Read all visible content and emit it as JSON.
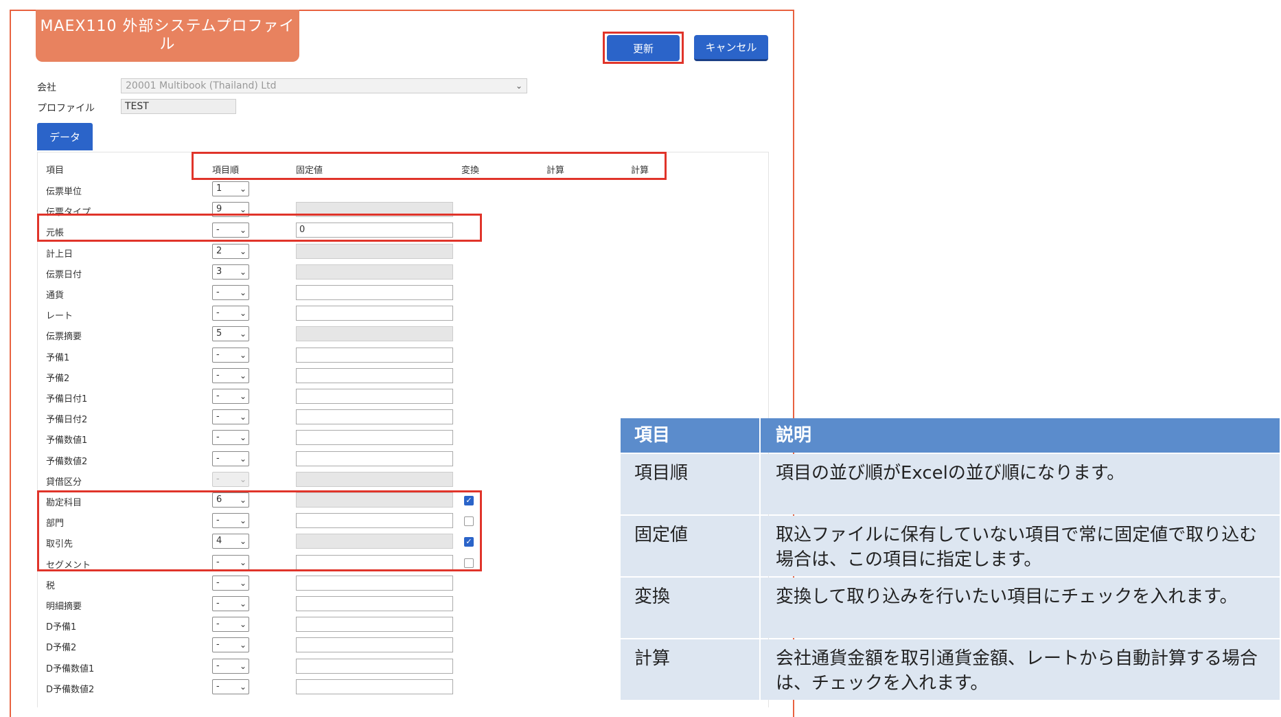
{
  "app": {
    "title": "MAEX110 外部システムプロファイル",
    "update_label": "更新",
    "cancel_label": "キャンセル",
    "accent": "#2b64c9",
    "title_color": "#e8825f",
    "highlight": "#e0342a"
  },
  "form": {
    "company_label": "会社",
    "company_value": "20001 Multibook (Thailand) Ltd",
    "profile_label": "プロファイル",
    "profile_value": "TEST"
  },
  "tabs": {
    "data_label": "データ"
  },
  "grid": {
    "headers": {
      "item": "項目",
      "order": "項目順",
      "fixed": "固定値",
      "convert": "変換",
      "calc1": "計算",
      "calc2": "計算"
    },
    "rows": [
      {
        "label": "伝票単位",
        "order": "1",
        "fixed": "",
        "fixed_disabled": false,
        "show_fixed": false,
        "checkbox": null,
        "order_disabled": false
      },
      {
        "label": "伝票タイプ",
        "order": "9",
        "fixed": "",
        "fixed_disabled": true,
        "show_fixed": true,
        "checkbox": null,
        "order_disabled": false
      },
      {
        "label": "元帳",
        "order": "-",
        "fixed": "0",
        "fixed_disabled": false,
        "show_fixed": true,
        "checkbox": null,
        "order_disabled": false
      },
      {
        "label": "計上日",
        "order": "2",
        "fixed": "",
        "fixed_disabled": true,
        "show_fixed": true,
        "checkbox": null,
        "order_disabled": false
      },
      {
        "label": "伝票日付",
        "order": "3",
        "fixed": "",
        "fixed_disabled": true,
        "show_fixed": true,
        "checkbox": null,
        "order_disabled": false
      },
      {
        "label": "通貨",
        "order": "-",
        "fixed": "",
        "fixed_disabled": false,
        "show_fixed": true,
        "checkbox": null,
        "order_disabled": false
      },
      {
        "label": "レート",
        "order": "-",
        "fixed": "",
        "fixed_disabled": false,
        "show_fixed": true,
        "checkbox": null,
        "order_disabled": false
      },
      {
        "label": "伝票摘要",
        "order": "5",
        "fixed": "",
        "fixed_disabled": true,
        "show_fixed": true,
        "checkbox": null,
        "order_disabled": false
      },
      {
        "label": "予備1",
        "order": "-",
        "fixed": "",
        "fixed_disabled": false,
        "show_fixed": true,
        "checkbox": null,
        "order_disabled": false
      },
      {
        "label": "予備2",
        "order": "-",
        "fixed": "",
        "fixed_disabled": false,
        "show_fixed": true,
        "checkbox": null,
        "order_disabled": false
      },
      {
        "label": "予備日付1",
        "order": "-",
        "fixed": "",
        "fixed_disabled": false,
        "show_fixed": true,
        "checkbox": null,
        "order_disabled": false
      },
      {
        "label": "予備日付2",
        "order": "-",
        "fixed": "",
        "fixed_disabled": false,
        "show_fixed": true,
        "checkbox": null,
        "order_disabled": false
      },
      {
        "label": "予備数値1",
        "order": "-",
        "fixed": "",
        "fixed_disabled": false,
        "show_fixed": true,
        "checkbox": null,
        "order_disabled": false
      },
      {
        "label": "予備数値2",
        "order": "-",
        "fixed": "",
        "fixed_disabled": false,
        "show_fixed": true,
        "checkbox": null,
        "order_disabled": false
      },
      {
        "label": "貸借区分",
        "order": "-",
        "fixed": "",
        "fixed_disabled": true,
        "show_fixed": true,
        "checkbox": null,
        "order_disabled": true
      },
      {
        "label": "勘定科目",
        "order": "6",
        "fixed": "",
        "fixed_disabled": true,
        "show_fixed": true,
        "checkbox": true,
        "order_disabled": false
      },
      {
        "label": "部門",
        "order": "-",
        "fixed": "",
        "fixed_disabled": false,
        "show_fixed": true,
        "checkbox": false,
        "order_disabled": false
      },
      {
        "label": "取引先",
        "order": "4",
        "fixed": "",
        "fixed_disabled": true,
        "show_fixed": true,
        "checkbox": true,
        "order_disabled": false
      },
      {
        "label": "セグメント",
        "order": "-",
        "fixed": "",
        "fixed_disabled": false,
        "show_fixed": true,
        "checkbox": false,
        "order_disabled": false
      },
      {
        "label": "税",
        "order": "-",
        "fixed": "",
        "fixed_disabled": false,
        "show_fixed": true,
        "checkbox": null,
        "order_disabled": false
      },
      {
        "label": "明細摘要",
        "order": "-",
        "fixed": "",
        "fixed_disabled": false,
        "show_fixed": true,
        "checkbox": null,
        "order_disabled": false
      },
      {
        "label": "D予備1",
        "order": "-",
        "fixed": "",
        "fixed_disabled": false,
        "show_fixed": true,
        "checkbox": null,
        "order_disabled": false
      },
      {
        "label": "D予備2",
        "order": "-",
        "fixed": "",
        "fixed_disabled": false,
        "show_fixed": true,
        "checkbox": null,
        "order_disabled": false
      },
      {
        "label": "D予備数値1",
        "order": "-",
        "fixed": "",
        "fixed_disabled": false,
        "show_fixed": true,
        "checkbox": null,
        "order_disabled": false
      },
      {
        "label": "D予備数値2",
        "order": "-",
        "fixed": "",
        "fixed_disabled": false,
        "show_fixed": true,
        "checkbox": null,
        "order_disabled": false
      }
    ]
  },
  "explanation": {
    "header_item": "項目",
    "header_desc": "説明",
    "rows": [
      {
        "item": "項目順",
        "desc": "項目の並び順がExcelの並び順になります。"
      },
      {
        "item": "固定値",
        "desc": "取込ファイルに保有していない項目で常に固定値で取り込む場合は、この項目に指定します。"
      },
      {
        "item": "変換",
        "desc": "変換して取り込みを行いたい項目にチェックを入れます。"
      },
      {
        "item": "計算",
        "desc": "会社通貨金額を取引通貨金額、レートから自動計算する場合は、チェックを入れます。"
      }
    ]
  }
}
